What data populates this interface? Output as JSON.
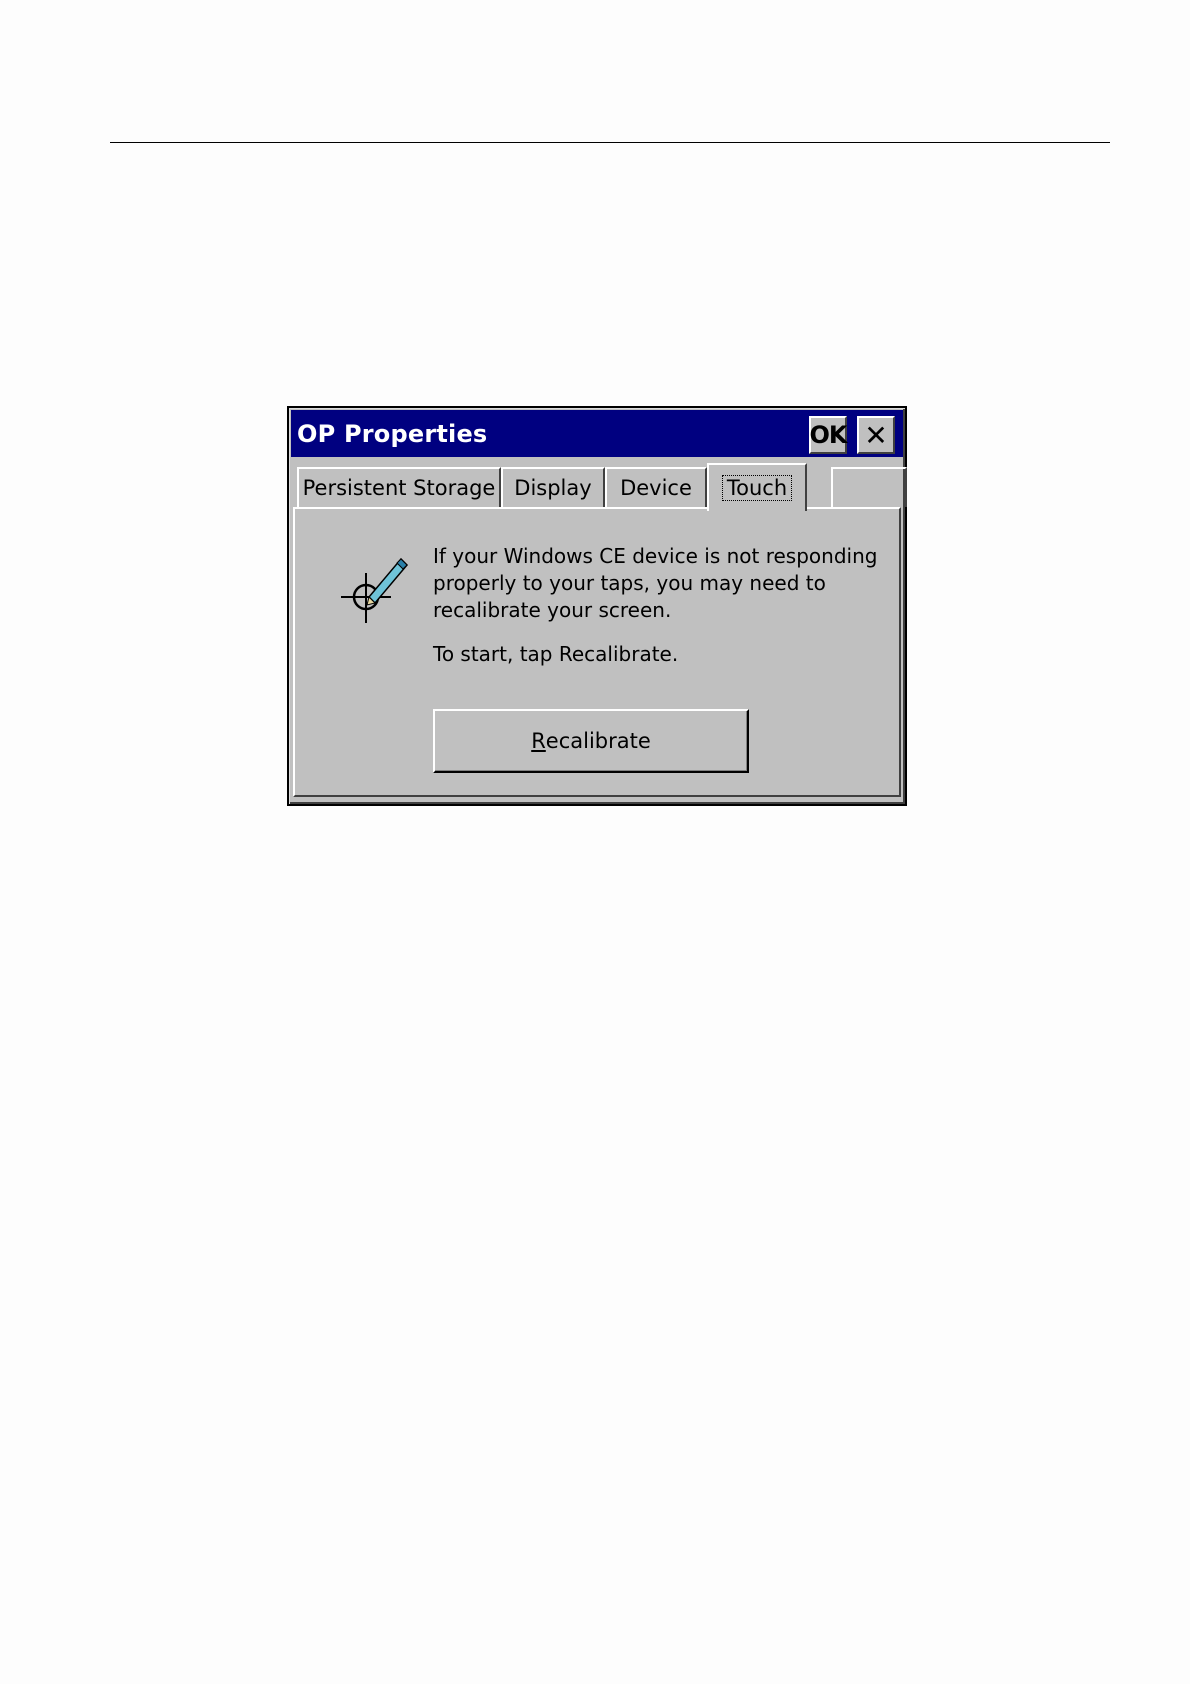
{
  "dialog": {
    "title": "OP Properties",
    "ok_label": "OK",
    "close_glyph": "✕"
  },
  "tabs": [
    {
      "label": "Persistent Storage",
      "active": false
    },
    {
      "label": "Display",
      "active": false
    },
    {
      "label": "Device",
      "active": false
    },
    {
      "label": "Touch",
      "active": true
    }
  ],
  "panel": {
    "icon": "touch-calibration-icon",
    "message": "If your Windows CE device is not responding properly to your taps, you may need to recalibrate your screen.",
    "start_text": "To start, tap Recalibrate.",
    "button": {
      "mnemonic": "R",
      "rest": "ecalibrate"
    }
  },
  "colors": {
    "titlebar": "#000080",
    "face": "#c0c0c0"
  }
}
